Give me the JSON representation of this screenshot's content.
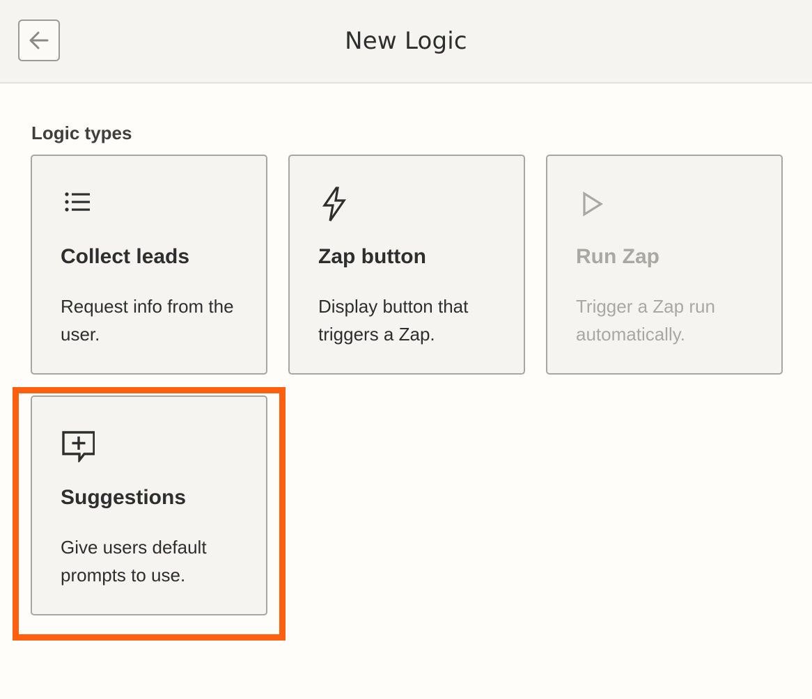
{
  "header": {
    "title": "New Logic",
    "back_icon": "arrow-left-icon"
  },
  "section": {
    "label": "Logic types"
  },
  "cards": [
    {
      "title": "Collect leads",
      "description": "Request info from the user.",
      "icon": "list-icon",
      "enabled": true
    },
    {
      "title": "Zap button",
      "description": "Display button that triggers a Zap.",
      "icon": "lightning-icon",
      "enabled": true
    },
    {
      "title": "Run Zap",
      "description": "Trigger a Zap run automatically.",
      "icon": "play-icon",
      "enabled": false
    },
    {
      "title": "Suggestions",
      "description": "Give users default prompts to use.",
      "icon": "chat-plus-icon",
      "enabled": true
    }
  ],
  "colors": {
    "highlight": "#ff6010",
    "disabled_text": "#a9a8a3",
    "text": "#2d2e2e"
  }
}
